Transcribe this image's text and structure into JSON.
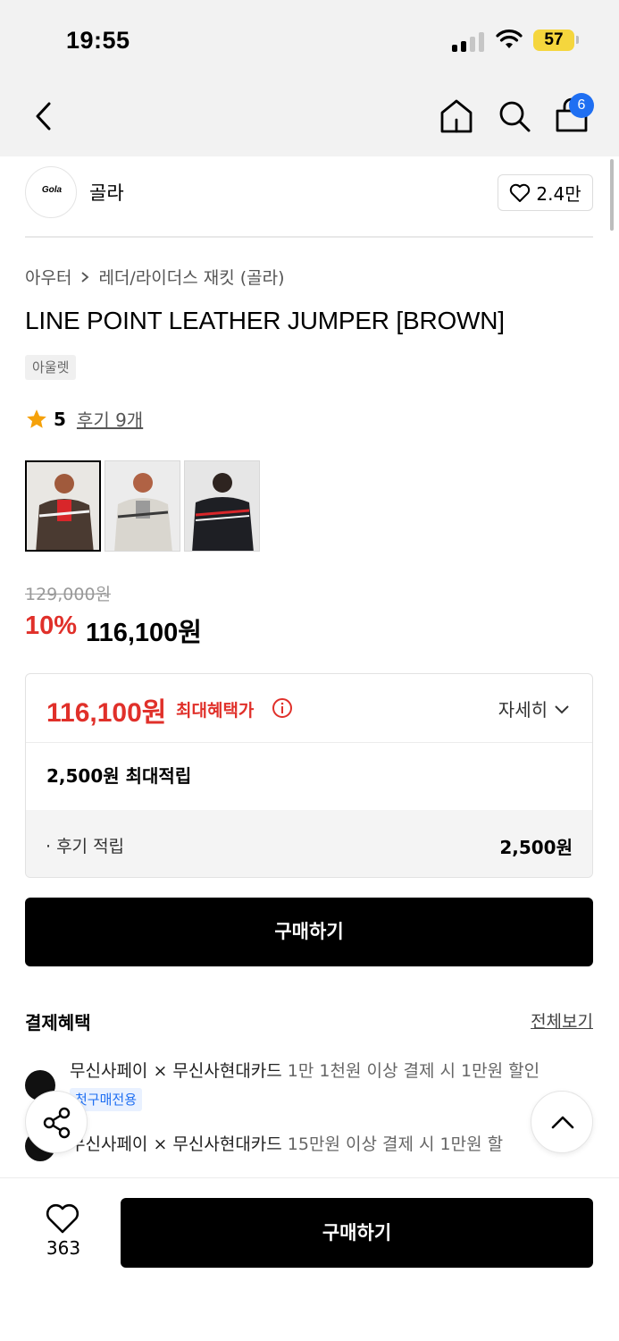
{
  "status_bar": {
    "time": "19:55",
    "battery": "57"
  },
  "nav": {
    "cart_count": "6"
  },
  "brand": {
    "logo_text": "Gola",
    "name": "골라",
    "likes": "2.4만"
  },
  "breadcrumb": {
    "category": "아우터",
    "subcategory": "레더/라이더스 재킷 (골라)"
  },
  "product": {
    "title": "LINE POINT LEATHER JUMPER [BROWN]",
    "tag": "아울렛",
    "rating": "5",
    "reviews": "후기 9개",
    "original_price": "129,000원",
    "discount": "10%",
    "sale_price": "116,100원"
  },
  "benefits": {
    "max_price": "116,100원",
    "max_label": "최대혜택가",
    "detail_label": "자세히",
    "max_points": "2,500원 최대적립",
    "review_label": "· 후기 적립",
    "review_value": "2,500원"
  },
  "buy_button": "구매하기",
  "payment": {
    "heading": "결제혜택",
    "view_all": "전체보기",
    "items": [
      {
        "title": "무신사페이 × 무신사현대카드",
        "desc": " 1만 1천원 이상 결제 시 1만원 할인",
        "chip": "첫구매전용"
      },
      {
        "title": "무신사페이 × 무신사현대카드",
        "desc": " 15만원 이상 결제 시 1만원 할"
      }
    ]
  },
  "bottom_bar": {
    "like_count": "363",
    "buy_label": "구매하기"
  },
  "colors": {
    "accent_red": "#e0302a",
    "badge_blue": "#1f6ff2",
    "battery_yellow": "#f5d63d"
  }
}
